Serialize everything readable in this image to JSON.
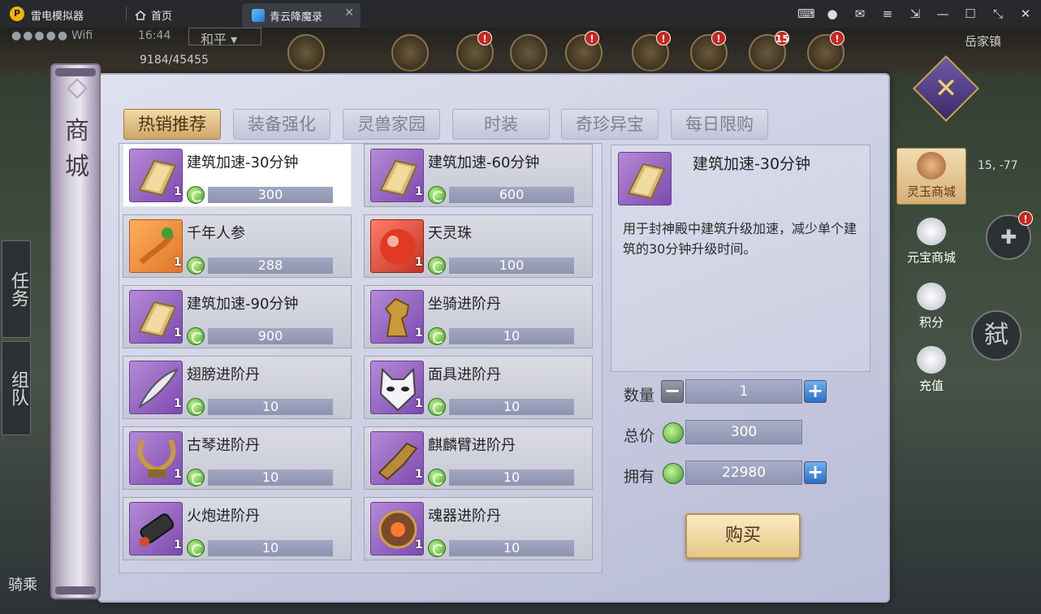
{
  "emulator": {
    "app_name": "雷电模拟器",
    "home_tab": "首页",
    "game_tab": "青云降魔录"
  },
  "game_hud": {
    "status_wifi": "Wifi",
    "time": "16:44",
    "pk_mode": "和平",
    "exp": "9184/45455",
    "location": "岳家镇",
    "coords": "15, -77",
    "badge_15": "15",
    "badge_alert": "!",
    "left_buttons": [
      "任务",
      "组队"
    ],
    "right_round": "弑",
    "bottom_left": "骑乘"
  },
  "shop": {
    "scroll_title": "商城",
    "tabs": [
      {
        "label": "热销推荐",
        "active": true
      },
      {
        "label": "装备强化",
        "active": false
      },
      {
        "label": "灵兽家园",
        "active": false
      },
      {
        "label": "时装",
        "active": false
      },
      {
        "label": "奇珍异宝",
        "active": false
      },
      {
        "label": "每日限购",
        "active": false
      }
    ],
    "items": [
      {
        "name": "建筑加速-30分钟",
        "qty": "1",
        "price": "300",
        "icon": "book-icon",
        "selected": true
      },
      {
        "name": "建筑加速-60分钟",
        "qty": "1",
        "price": "600",
        "icon": "book-icon",
        "selected": false
      },
      {
        "name": "千年人参",
        "qty": "1",
        "price": "288",
        "icon": "ginseng-icon",
        "selected": false
      },
      {
        "name": "天灵珠",
        "qty": "1",
        "price": "100",
        "icon": "orb-icon",
        "selected": false
      },
      {
        "name": "建筑加速-90分钟",
        "qty": "1",
        "price": "900",
        "icon": "book-icon",
        "selected": false
      },
      {
        "name": "坐骑进阶丹",
        "qty": "1",
        "price": "10",
        "icon": "horse-icon",
        "selected": false
      },
      {
        "name": "翅膀进阶丹",
        "qty": "1",
        "price": "10",
        "icon": "feather-icon",
        "selected": false
      },
      {
        "name": "面具进阶丹",
        "qty": "1",
        "price": "10",
        "icon": "mask-icon",
        "selected": false
      },
      {
        "name": "古琴进阶丹",
        "qty": "1",
        "price": "10",
        "icon": "lyre-icon",
        "selected": false
      },
      {
        "name": "麒麟臂进阶丹",
        "qty": "1",
        "price": "10",
        "icon": "arm-icon",
        "selected": false
      },
      {
        "name": "火炮进阶丹",
        "qty": "1",
        "price": "10",
        "icon": "cannon-icon",
        "selected": false
      },
      {
        "name": "魂器进阶丹",
        "qty": "1",
        "price": "10",
        "icon": "amulet-icon",
        "selected": false
      }
    ],
    "detail": {
      "name": "建筑加速-30分钟",
      "description": "用于封神殿中建筑升级加速，减少单个建筑的30分钟升级时间。"
    },
    "quantity_label": "数量",
    "quantity_value": "1",
    "total_label": "总价",
    "total_value": "300",
    "owned_label": "拥有",
    "owned_value": "22980",
    "buy_label": "购买",
    "side_nav": [
      {
        "label": "灵玉商城",
        "active": true,
        "icon": "dragon-icon"
      },
      {
        "label": "元宝商城",
        "active": false,
        "icon": "ingot-icon"
      },
      {
        "label": "积分",
        "active": false,
        "icon": "bag-icon"
      },
      {
        "label": "充值",
        "active": false,
        "icon": "recharge-icon"
      }
    ]
  }
}
